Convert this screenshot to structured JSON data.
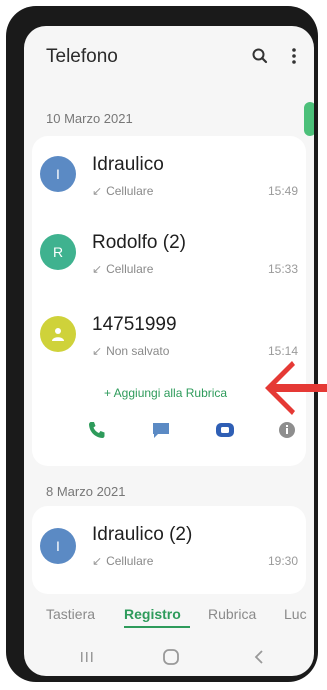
{
  "app_title": "Telefono",
  "header": {
    "search_icon": "search-icon",
    "more_icon": "more-vert-icon"
  },
  "groups": [
    {
      "date": "10 Marzo 2021",
      "calls": [
        {
          "initial": "I",
          "name": "Idraulico",
          "type": "Cellulare",
          "time": "15:49",
          "avatar_color": "#5b8ac4"
        },
        {
          "initial": "R",
          "name": "Rodolfo (2)",
          "type": "Cellulare",
          "time": "15:33",
          "avatar_color": "#3fb28f"
        },
        {
          "initial": "",
          "name": "14751999",
          "type": "Non salvato",
          "time": "15:14",
          "avatar_color": "#cfd23a"
        }
      ],
      "add_contact": "+ Aggiungi alla Rubrica"
    },
    {
      "date": "8 Marzo 2021",
      "calls": [
        {
          "initial": "I",
          "name": "Idraulico (2)",
          "type": "Cellulare",
          "time": "19:30",
          "avatar_color": "#5b8ac4"
        }
      ]
    }
  ],
  "tabs": [
    "Tastiera",
    "Registro",
    "Rubrica",
    "Luc"
  ],
  "active_tab": "Registro",
  "colors": {
    "accent": "#2e9b5b",
    "arrow": "#e53935"
  }
}
